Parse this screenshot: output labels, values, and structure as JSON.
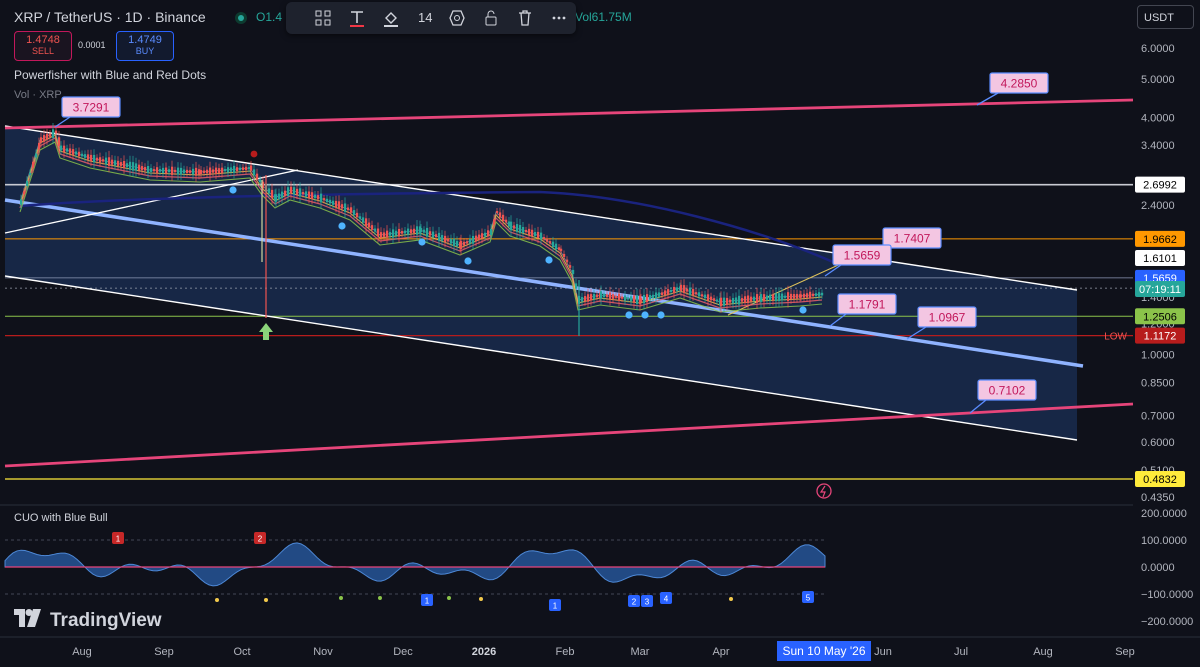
{
  "header": {
    "title": "XRP / TetherUS · 1D · Binance",
    "ohlc": "O1.4",
    "volume_text": "Vol61.75M",
    "sell_price": "1.4748",
    "sell_label": "SELL",
    "buy_price": "1.4749",
    "buy_label": "BUY",
    "spread": "0.0001",
    "indicator_main": "Powerfisher with Blue and Red Dots",
    "indicator_vol": "Vol · XRP",
    "indicator_osc": "CUO with Blue Bull",
    "currency": "USDT",
    "logo": "TradingView"
  },
  "toolbar": {
    "items": [
      "grid-icon",
      "text-tool-icon",
      "fill-icon",
      "width-14",
      "settings-hex-icon",
      "lock-icon",
      "trash-icon",
      "more-icon"
    ],
    "line_width": "14"
  },
  "colors": {
    "up": "#26a69a",
    "down": "#ef5350",
    "channel_fill": "#1f3a6b",
    "pink_line": "#e6457a",
    "mid_line": "#8fb3ff",
    "navy_ma": "#1a237e",
    "label_bg": "#f3c6e2",
    "label_text": "#c2185b"
  },
  "chart_data": [
    {
      "type": "line",
      "subtype": "candlestick_with_trendlines",
      "title": "XRP / TetherUS · 1D · Binance",
      "x_axis_ticks": [
        "Aug",
        "Sep",
        "Oct",
        "Nov",
        "Dec",
        "2026",
        "Feb",
        "Mar",
        "Apr",
        "May",
        "Jun",
        "Jul",
        "Aug",
        "Sep"
      ],
      "crosshair_date": "Sun 10 May '26",
      "y_scale": "log",
      "y_axis_ticks": [
        "6.0000",
        "5.0000",
        "4.0000",
        "3.4000",
        "2.4000",
        "1.4000",
        "1.2000",
        "1.0000",
        "0.8500",
        "0.7000",
        "0.6000",
        "0.5100",
        "0.4350"
      ],
      "ylim": [
        0.43,
        6.6
      ],
      "series": [
        {
          "name": "XRP price (approx.)",
          "x": [
            "Jul 18",
            "Jul 22",
            "Aug 1",
            "Aug 20",
            "Sep 10",
            "Oct 5",
            "Oct 10",
            "Oct 20",
            "Nov 5",
            "Nov 20",
            "Dec 5",
            "Dec 25",
            "Jan 5",
            "Jan 20",
            "Feb 1",
            "Feb 6",
            "Feb 20",
            "Mar 10",
            "Apr 1",
            "Apr 15",
            "May 1",
            "May 10"
          ],
          "values": [
            2.95,
            3.73,
            3.2,
            3.05,
            2.95,
            2.95,
            2.45,
            2.55,
            2.3,
            2.1,
            2.0,
            1.88,
            2.35,
            2.05,
            1.68,
            1.38,
            1.42,
            1.38,
            1.33,
            1.37,
            1.42,
            1.4748
          ]
        }
      ],
      "annotations": [
        {
          "label": "3.7291",
          "kind": "price_label"
        },
        {
          "label": "4.2850",
          "kind": "price_label"
        },
        {
          "label": "1.7407",
          "kind": "price_label"
        },
        {
          "label": "1.5659",
          "kind": "price_label"
        },
        {
          "label": "1.1791",
          "kind": "price_label"
        },
        {
          "label": "1.0967",
          "kind": "price_label"
        },
        {
          "label": "0.7102",
          "kind": "price_label"
        }
      ],
      "price_badges": [
        {
          "label": "2.6992",
          "color": "#ffffff",
          "text": "#000000"
        },
        {
          "label": "1.9662",
          "color": "#ff9800",
          "text": "#000000"
        },
        {
          "label": "1.6101",
          "color": "#ffffff",
          "text": "#000000"
        },
        {
          "label": "1.5659",
          "color": "#2962ff",
          "text": "#ffffff"
        },
        {
          "label": "07:19:11",
          "color": "#26a69a",
          "text": "#ffffff"
        },
        {
          "label": "1.2506",
          "color": "#8bc34a",
          "text": "#000000"
        },
        {
          "label": "1.1172",
          "color": "#b71c1c",
          "text": "#ffffff"
        },
        {
          "label": "0.4832",
          "color": "#ffeb3b",
          "text": "#000000"
        }
      ],
      "low_label": "LOW",
      "horizontal_levels": [
        2.6992,
        1.9662,
        1.5659,
        1.4748,
        1.2506,
        1.1172,
        0.4832
      ],
      "grid": false
    },
    {
      "type": "area",
      "title": "CUO with Blue Bull",
      "y_axis_ticks": [
        "200.0000",
        "100.0000",
        "0.0000",
        "−100.0000",
        "−200.0000"
      ],
      "ylim": [
        -230,
        230
      ],
      "signal_badges_red": [
        "1",
        "2"
      ],
      "signal_badges_blue": [
        "1",
        "1",
        "2",
        "3",
        "4",
        "5"
      ]
    }
  ]
}
